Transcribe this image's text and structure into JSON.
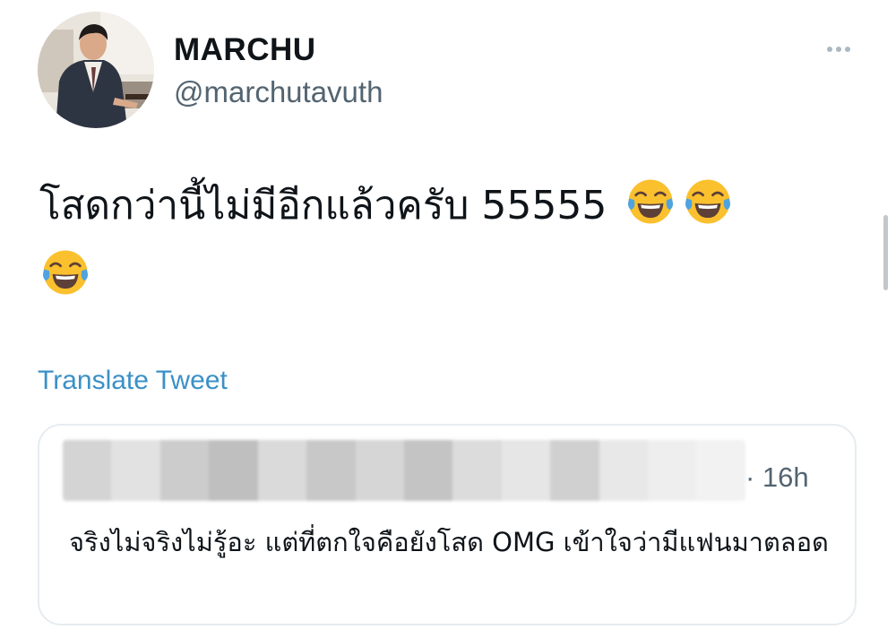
{
  "author": {
    "display_name": "MARCHU",
    "handle": "@marchutavuth"
  },
  "icons": {
    "avatar": "profile-photo",
    "more": "more-options-icon",
    "emoji": "face-with-tears-of-joy-emoji"
  },
  "tweet": {
    "text": "โสดกว่านี้ไม่มีอีกแล้วครับ 55555",
    "translate_label": "Translate Tweet"
  },
  "quote": {
    "timestamp": "· 16h",
    "text": "จริงไม่จริงไม่รู้อะ แต่ที่ตกใจคือยังโสด OMG เข้าใจว่ามีแฟนมาตลอด"
  },
  "colors": {
    "link": "#3b90c7",
    "secondary_text": "#536471",
    "border": "#e6ecf0"
  }
}
